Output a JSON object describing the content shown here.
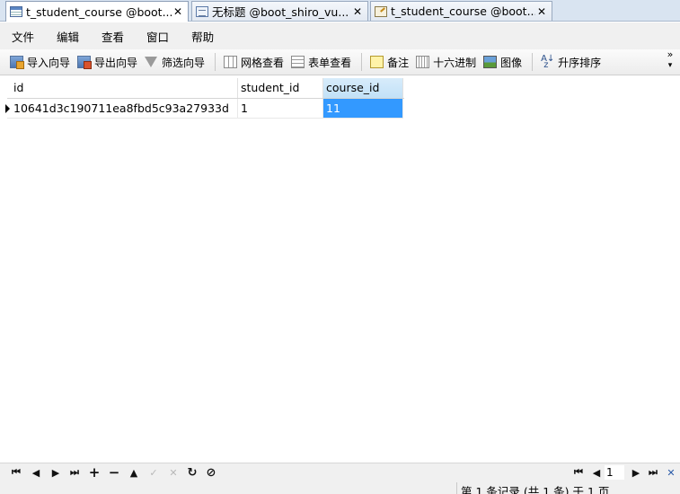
{
  "tabs": [
    {
      "label": "t_student_course @boot...",
      "icon": "table-icon",
      "active": true
    },
    {
      "label": "无标题 @boot_shiro_vu...",
      "icon": "query-icon",
      "active": false
    },
    {
      "label": "t_student_course @boot...",
      "icon": "table-design-icon",
      "active": false
    }
  ],
  "tab_close": "✕",
  "menu": [
    "文件",
    "编辑",
    "查看",
    "窗口",
    "帮助"
  ],
  "toolbar": {
    "import_wizard": "导入向导",
    "export_wizard": "导出向导",
    "filter_wizard": "筛选向导",
    "grid_view": "网格查看",
    "form_view": "表单查看",
    "memo": "备注",
    "hex": "十六进制",
    "image": "图像",
    "sort_asc": "升序排序",
    "more": "»"
  },
  "grid": {
    "columns": [
      "id",
      "student_id",
      "course_id"
    ],
    "selected_column": "course_id",
    "rows": [
      {
        "id": "10641d3c190711ea8fbd5c93a27933d",
        "student_id": "1",
        "course_id": "11"
      }
    ]
  },
  "nav": {
    "first": "⏮",
    "prev": "◀",
    "next": "▶",
    "last": "⏭",
    "add": "+",
    "delete": "−",
    "apply": "▲",
    "cancel_edit": "✓",
    "discard": "✕",
    "refresh": "↻",
    "stop": "⊘",
    "page": "1"
  },
  "status": "第 1 条记录 (共 1 条) 于 1 页",
  "colors": {
    "selection": "#3399ff",
    "header_selected": "#c2e1f7"
  }
}
